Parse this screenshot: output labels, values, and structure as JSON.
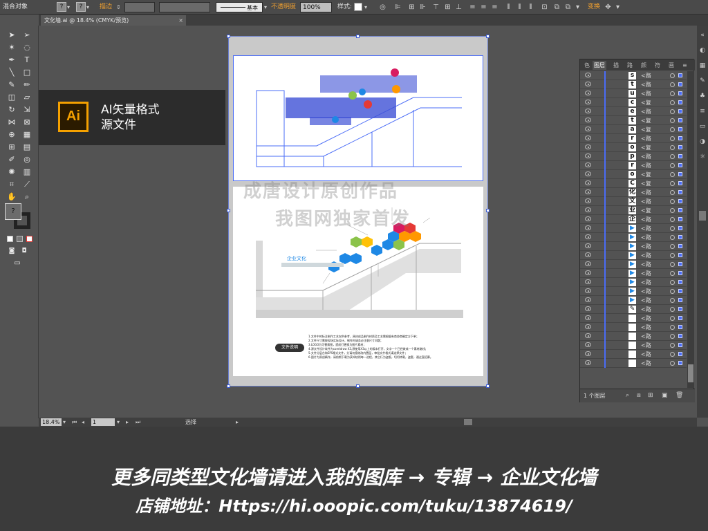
{
  "control_bar": {
    "selection_label": "混合对象",
    "fill_swatch": "?",
    "stroke_swatch": "?",
    "stroke_label": "描边",
    "stroke_style_label": "基本",
    "opacity_label": "不透明度",
    "opacity_value": "100%",
    "style_label": "样式:",
    "transform_label": "变换"
  },
  "document_tab": {
    "title": "文化墙.ai @ 18.4% (CMYK/预览)",
    "close": "×"
  },
  "ai_banner": {
    "logo": "Ai",
    "line1": "AI矢量格式",
    "line2": "源文件"
  },
  "canvas": {
    "explain_title": "文件说明",
    "explain_lines": [
      "1.文件中的标注制作工艺仅供参考，具体成品制作材质及工艺需根据有商协商确定方下单；",
      "2.文件尺寸需按现场实际设计，制作时请务必注意尺寸问题；",
      "3.LOGO为可替换图，提前打更换为图片素材；",
      "4.源文件设计软件为coreldraw X3,源使用X3以上的版本打开，文字一个已经做成一个素材路线；",
      "5.文件分层台和EPS格式文件，分请勿擅修改内置层，审批文件格式请选择文件；",
      "6.图片为原创精作，请前期下载为获知较彻每一进程，其它行为盗版，切切转载，盗套，通过直招募。"
    ],
    "watermark_big": "成唐设计原创作品",
    "watermark_big2": "我图网独家首发",
    "watermark_small": "我图网"
  },
  "status_bar": {
    "zoom": "18.4%",
    "page": "1",
    "tool": "选择"
  },
  "layers_panel": {
    "tabs": [
      "色",
      "图层",
      "描",
      "路",
      "颜",
      "符",
      "画"
    ],
    "active_tab": "图层",
    "footer_count": "1 个图层",
    "rows": [
      {
        "thumb": "s",
        "name": "<路"
      },
      {
        "thumb": "t",
        "name": "<路"
      },
      {
        "thumb": "u",
        "name": "<路"
      },
      {
        "thumb": "c",
        "name": "<复"
      },
      {
        "thumb": "e",
        "name": "<路"
      },
      {
        "thumb": "t",
        "name": "<复"
      },
      {
        "thumb": "a",
        "name": "<复"
      },
      {
        "thumb": "r",
        "name": "<路"
      },
      {
        "thumb": "o",
        "name": "<复"
      },
      {
        "thumb": "p",
        "name": "<路"
      },
      {
        "thumb": "r",
        "name": "<路"
      },
      {
        "thumb": "o",
        "name": "<复"
      },
      {
        "thumb": "C",
        "name": "<复"
      },
      {
        "thumb": "化",
        "name": "<路"
      },
      {
        "thumb": "文",
        "name": "<路"
      },
      {
        "thumb": "业",
        "name": "<复"
      },
      {
        "thumb": "企",
        "name": "<路"
      },
      {
        "thumb": "▶",
        "name": "<路"
      },
      {
        "thumb": "▶",
        "name": "<路"
      },
      {
        "thumb": "▶",
        "name": "<路"
      },
      {
        "thumb": "▶",
        "name": "<路"
      },
      {
        "thumb": "▶",
        "name": "<路"
      },
      {
        "thumb": "▶",
        "name": "<路"
      },
      {
        "thumb": "▶",
        "name": "<路"
      },
      {
        "thumb": "▶",
        "name": "<路"
      },
      {
        "thumb": "▶",
        "name": "<路"
      },
      {
        "thumb": "✎",
        "name": "<路"
      },
      {
        "thumb": "",
        "name": "<路"
      },
      {
        "thumb": "",
        "name": "<路"
      },
      {
        "thumb": "",
        "name": "<路"
      },
      {
        "thumb": "",
        "name": "<路"
      },
      {
        "thumb": "",
        "name": "<路"
      },
      {
        "thumb": "",
        "name": "<路"
      }
    ]
  },
  "footer": {
    "line1": "更多同类型文化墙请进入我的图库 → 专辑 → 企业文化墙",
    "line2": "店铺地址：Https://hi.ooopic.com/tuku/13874619/"
  },
  "colors": {
    "accent_blue": "#4a6cf7",
    "hex_blue": "#1e88e5",
    "hex_green": "#8bc34a",
    "hex_orange": "#ff9800",
    "hex_red": "#e53935",
    "hex_magenta": "#d81b60",
    "ai_orange": "#f5a100"
  }
}
